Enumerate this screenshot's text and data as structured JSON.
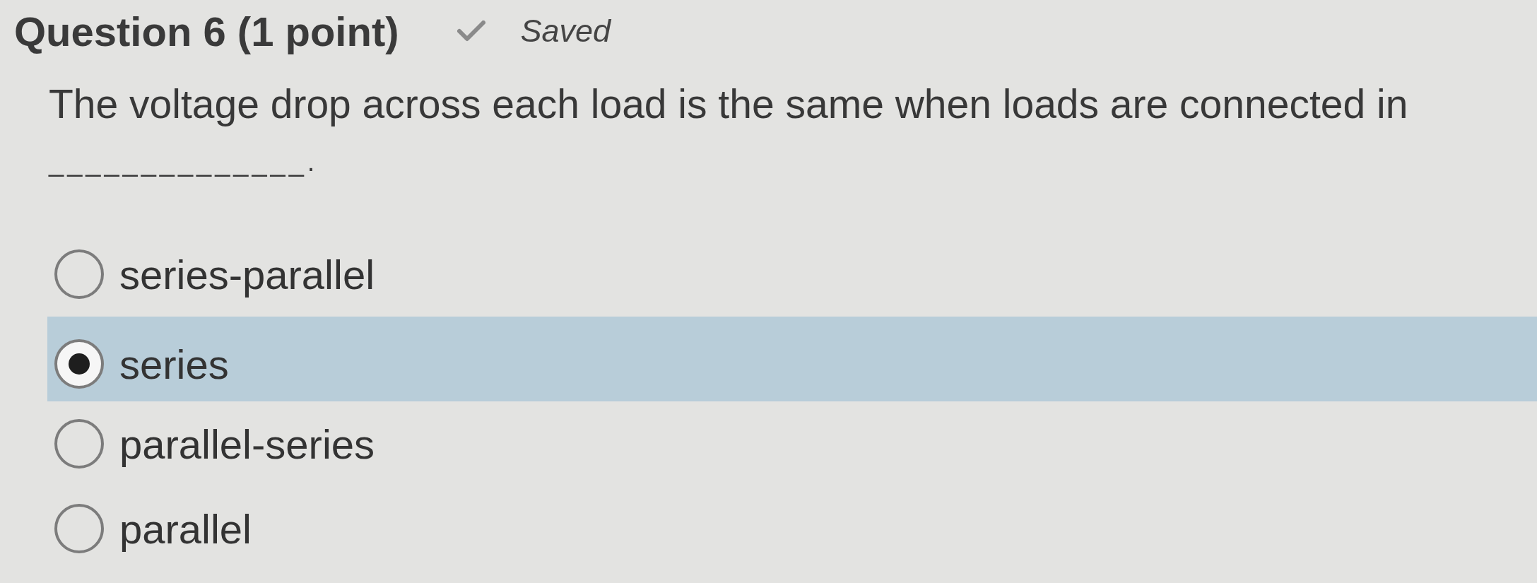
{
  "question": {
    "title": "Question 6 (1 point)",
    "save_status": "Saved"
  },
  "prompt": "The voltage drop across each load is the same when loads are connected in",
  "blank": "______________.",
  "options": [
    {
      "label": "series-parallel",
      "selected": false
    },
    {
      "label": "series",
      "selected": true
    },
    {
      "label": "parallel-series",
      "selected": false
    },
    {
      "label": "parallel",
      "selected": false
    }
  ]
}
